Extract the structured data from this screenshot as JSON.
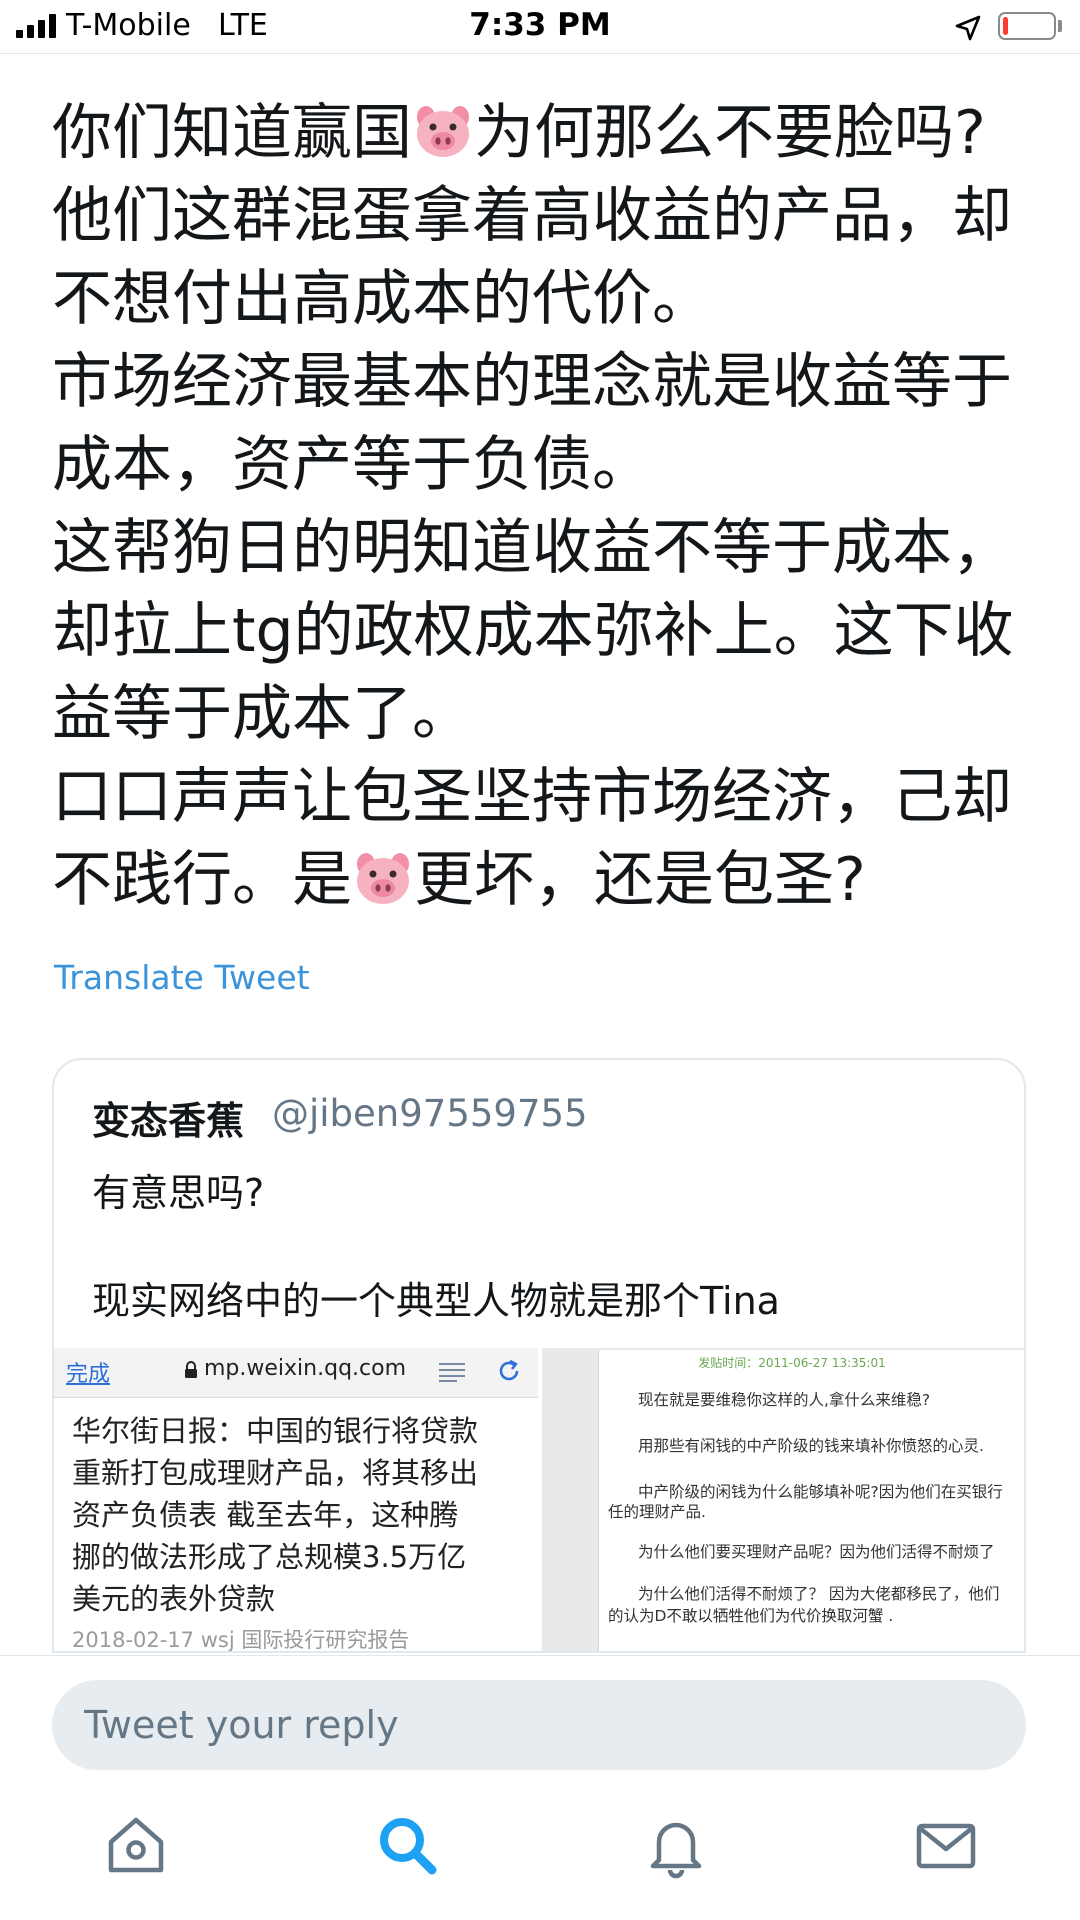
{
  "status_bar": {
    "carrier": "T-Mobile",
    "network": "LTE",
    "time": "7:33 PM",
    "battery_level": 0.1,
    "battery_color": "#ff3b30"
  },
  "tweet": {
    "lines": [
      "你们知道赢国",
      "为何那么不要脸吗?",
      "他们这群混蛋拿着高收益的产品，却",
      "不想付出高成本的代价。",
      "市场经济最基本的理念就是收益等于",
      "成本，资产等于负债。",
      "这帮狗日的明知道收益不等于成本，",
      "却拉上tg的政权成本弥补上。这下收",
      "益等于成本了。",
      "口口声声让包圣坚持市场经济，己却",
      "不践行。是",
      "更坏，还是包圣?"
    ],
    "emoji": "pig-face",
    "translate_label": "Translate Tweet",
    "link_color": "#3b94d9"
  },
  "quote": {
    "name": "变态香蕉",
    "handle": "@jiben97559755",
    "line1": "有意思吗?",
    "line2": "现实网络中的一个典型人物就是那个Tina",
    "media_left": {
      "done_label": "完成",
      "url": "mp.weixin.qq.com",
      "text_lines": [
        "华尔街日报：中国的银行将贷款",
        "重新打包成理财产品，将其移出",
        "资产负债表 截至去年，这种腾",
        "挪的做法形成了总规模3.5万亿",
        "美元的表外贷款"
      ],
      "meta": "2018-02-17  wsj  国际投行研究报告"
    },
    "media_right": {
      "date": "发贴时间：2011-06-27 13:35:01",
      "lines": [
        "现在就是要维稳你这样的人,拿什么来维稳?",
        "用那些有闲钱的中产阶级的钱来填补你愤怒的心灵.",
        "中产阶级的闲钱为什么能够填补呢?因为他们在买银行",
        "任的理财产品.",
        "为什么他们要买理财产品呢？因为他们活得不耐烦了",
        "为什么他们活得不耐烦了？  因为大佬都移民了，他们",
        "的认为D不敢以牺牲他们为代价换取河蟹 ."
      ]
    }
  },
  "reply": {
    "placeholder": "Tweet your reply"
  },
  "tabs": [
    "home",
    "search",
    "notifications",
    "messages"
  ],
  "colors": {
    "accent": "#1da1f2",
    "icon_gray": "#657786"
  }
}
